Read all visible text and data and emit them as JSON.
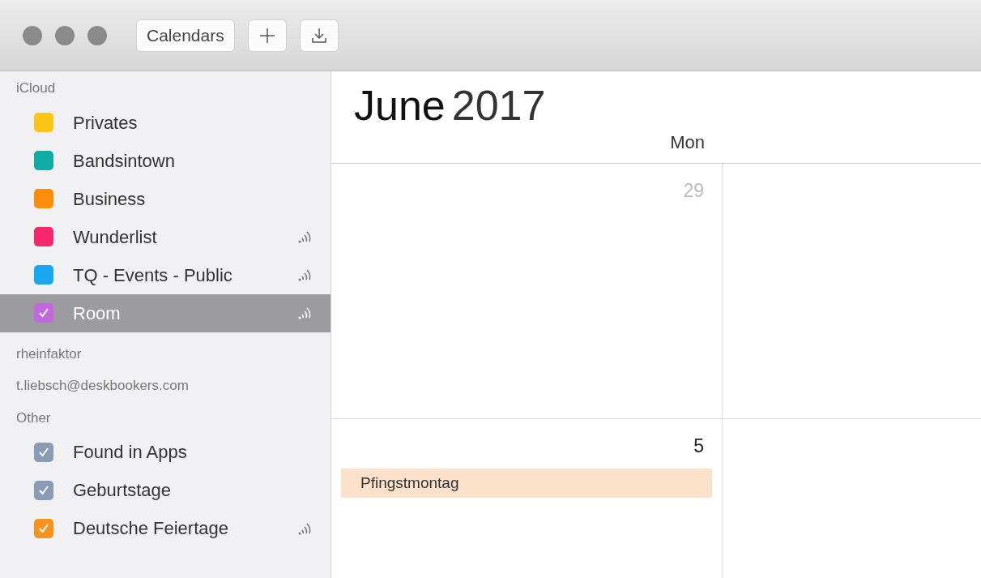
{
  "toolbar": {
    "buttons": [
      {
        "kind": "text",
        "label": "Calendars"
      },
      {
        "kind": "add"
      },
      {
        "kind": "import"
      }
    ]
  },
  "sidebar": {
    "groups": [
      {
        "title": "iCloud",
        "items": [
          {
            "label": "Privates",
            "color": "#fcc419",
            "checked": false,
            "selected": false,
            "subscribed": false
          },
          {
            "label": "Bandsintown",
            "color": "#12aaa5",
            "checked": false,
            "selected": false,
            "subscribed": false
          },
          {
            "label": "Business",
            "color": "#fb8c0c",
            "checked": false,
            "selected": false,
            "subscribed": false
          },
          {
            "label": "Wunderlist",
            "color": "#f5266a",
            "checked": false,
            "selected": false,
            "subscribed": true
          },
          {
            "label": "TQ - Events - Public",
            "color": "#1aa7f2",
            "checked": false,
            "selected": false,
            "subscribed": true
          },
          {
            "label": "Room",
            "color": "#c068dc",
            "checked": true,
            "selected": true,
            "subscribed": true
          }
        ]
      },
      {
        "title": "rheinfaktor"
      },
      {
        "title": "t.liebsch@deskbookers.com"
      },
      {
        "title": "Other",
        "items": [
          {
            "label": "Found in Apps",
            "color": "#8a9bb5",
            "checked": true,
            "selected": false,
            "subscribed": false
          },
          {
            "label": "Geburtstage",
            "color": "#8a9bb5",
            "checked": true,
            "selected": false,
            "subscribed": false
          },
          {
            "label": "Deutsche Feiertage",
            "color": "#f5931e",
            "checked": true,
            "selected": false,
            "subscribed": true
          }
        ]
      }
    ]
  },
  "calendar": {
    "month": "June",
    "year": "2017",
    "weekdays": [
      "Mon"
    ],
    "weeks": [
      {
        "day": "29",
        "other_month": true
      },
      {
        "day": "5",
        "other_month": false,
        "events": [
          {
            "title": "Pfingstmontag",
            "color": "#fde2cb"
          }
        ]
      }
    ]
  }
}
